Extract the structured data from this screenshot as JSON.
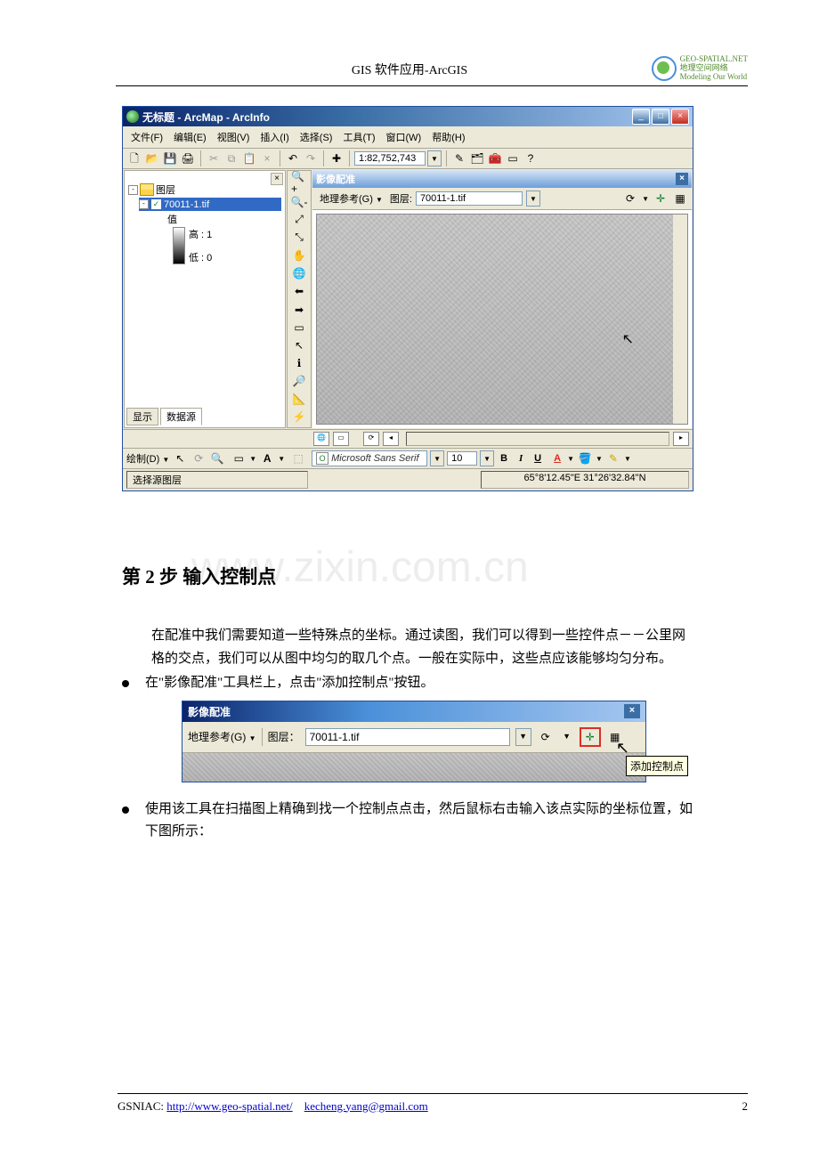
{
  "doc": {
    "header_title": "GIS 软件应用-ArcGIS",
    "logo_line1": "GEO-SPATIAL.NET",
    "logo_line2": "地理空间网络",
    "logo_line3": "Modeling Our World"
  },
  "arcmap": {
    "window_title": "无标题 - ArcMap - ArcInfo",
    "menu": [
      "文件(F)",
      "编辑(E)",
      "视图(V)",
      "插入(I)",
      "选择(S)",
      "工具(T)",
      "窗口(W)",
      "帮助(H)"
    ],
    "scale": "1:82,752,743",
    "toc": {
      "root": "图层",
      "layer": "70011-1.tif",
      "value_label": "值",
      "high_label": "高 : 1",
      "low_label": "低 : 0",
      "tabs": [
        "显示",
        "数据源"
      ]
    },
    "georef_title": "影像配准",
    "georef_menu": "地理参考(G)",
    "layer_label": "图层:",
    "layer_value": "70011-1.tif",
    "draw_label": "绘制(D)",
    "font_name": "Microsoft Sans Serif",
    "font_size": "10",
    "status_layer": "选择源图层",
    "status_coords": "65°8'12.45\"E  31°26'32.84\"N"
  },
  "section": {
    "heading": "第 2 步  输入控制点",
    "watermark": "www.zixin.com.cn",
    "paragraph": "在配准中我们需要知道一些特殊点的坐标。通过读图，我们可以得到一些控件点－－公里网格的交点，我们可以从图中均匀的取几个点。一般在实际中，这些点应该能够均匀分布。",
    "bullets": [
      "在\"影像配准\"工具栏上，点击\"添加控制点\"按钮。",
      "使用该工具在扫描图上精确到找一个控制点点击，然后鼠标右击输入该点实际的坐标位置，如下图所示："
    ]
  },
  "closeup": {
    "title": "影像配准",
    "georef_menu": "地理参考(G)",
    "layer_label": "图层：",
    "layer_value": "70011-1.tif",
    "tooltip": "添加控制点"
  },
  "footer": {
    "label": "GSNIAC: ",
    "url": "http://www.geo-spatial.net/",
    "email": "kecheng.yang@gmail.com",
    "page": "2"
  }
}
